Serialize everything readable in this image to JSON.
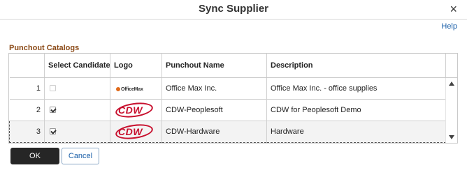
{
  "dialog": {
    "title": "Sync Supplier",
    "close_glyph": "×",
    "help_label": "Help"
  },
  "section": {
    "title": "Punchout Catalogs"
  },
  "grid": {
    "columns": [
      "Select Candidate",
      "Logo",
      "Punchout Name",
      "Description"
    ],
    "rows": [
      {
        "num": "1",
        "checked": false,
        "disabled": true,
        "logo": "officemax-logo",
        "logo_text": "OfficeMax",
        "name": "Office Max Inc.",
        "description": "Office Max Inc. - office supplies"
      },
      {
        "num": "2",
        "checked": true,
        "disabled": false,
        "logo": "cdw-logo",
        "logo_text": "CDW",
        "name": "CDW-Peoplesoft",
        "description": "CDW for Peoplesoft Demo"
      },
      {
        "num": "3",
        "checked": true,
        "disabled": false,
        "logo": "cdw-logo",
        "logo_text": "CDW",
        "name": "CDW-Hardware",
        "description": "Hardware"
      }
    ]
  },
  "footer": {
    "ok_label": "OK",
    "cancel_label": "Cancel"
  },
  "colors": {
    "section_title": "#8b4a17",
    "link": "#1a5fa8",
    "ok_button_bg": "#262626",
    "cdw_red": "#c8102e"
  }
}
